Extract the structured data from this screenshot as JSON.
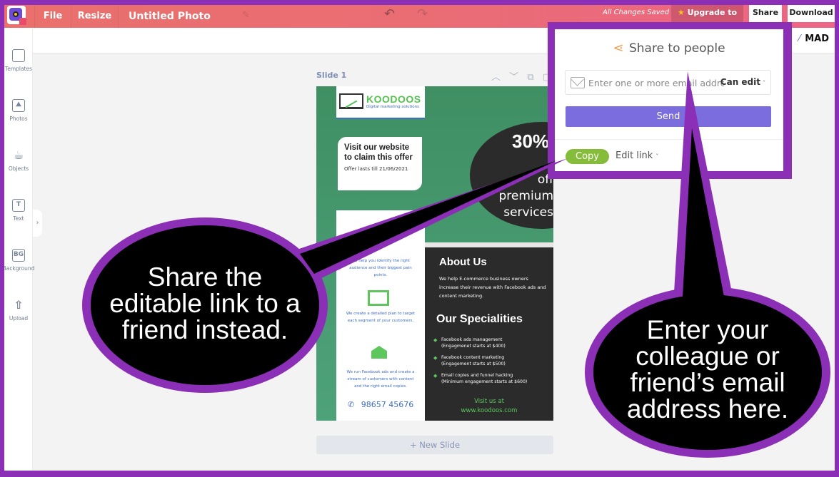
{
  "topbar": {
    "file_label": "File",
    "resize_label": "Resize",
    "document_title": "Untitled Photo",
    "save_status": "All Changes Saved",
    "upgrade_label": "Upgrade to pro",
    "share_label": "Share",
    "download_label": "Download"
  },
  "subbar": {
    "mad_label": "MAD"
  },
  "sidebar": {
    "items": [
      {
        "label": "Templates",
        "icon": "templates-icon"
      },
      {
        "label": "Photos",
        "icon": "photo-icon"
      },
      {
        "label": "Objects",
        "icon": "cup-icon"
      },
      {
        "label": "Text",
        "icon": "text-icon",
        "glyph": "T"
      },
      {
        "label": "Background",
        "icon": "background-icon",
        "glyph": "BG"
      },
      {
        "label": "Upload",
        "icon": "upload-icon",
        "glyph": "⇧"
      }
    ]
  },
  "canvas": {
    "slide_label": "Slide 1",
    "new_slide_label": "+ New Slide"
  },
  "slide": {
    "brand_name": "KOODOOS",
    "brand_tagline": "Digital marketing solutions",
    "offer_title": "Visit our website to claim this offer",
    "offer_date": "Offer lasts till 21/06/2021",
    "discount_pct": "30%",
    "discount_text": "off premium services",
    "step1_text": "We help you identify the right audience and their biggest pain points.",
    "step2_text": "We create a detailed plan to target each segment of your customers.",
    "step3_text": "We run Facebook ads and create a stream of customers with content and the right email copies.",
    "phone": "98657 45676",
    "about_title": "About Us",
    "about_body": "We help E-commerce business owners increase their revenue with Facebook ads and content marketing.",
    "specialities_title": "Our Specialities",
    "specialities": [
      {
        "line1": "Facebook ads management",
        "line2": "(Engagmenet starts at $400)"
      },
      {
        "line1": "Facebook content marketing",
        "line2": "(Engagement starts at $500)"
      },
      {
        "line1": "Email copies and funnel hacking",
        "line2": "(Minimum engagement starts at $600)"
      }
    ],
    "visit_line1": "Visit us at",
    "visit_line2": "www.koodoos.com"
  },
  "share_popup": {
    "heading": "Share to people",
    "email_placeholder": "Enter one or more email address",
    "email_value": "",
    "permission_selected": "Can edit",
    "send_label": "Send",
    "copy_label": "Copy",
    "edit_link_label": "Edit link"
  },
  "annotations": {
    "left_bubble": "Share the editable link to a friend instead.",
    "right_bubble": "Enter your colleague or friend’s email address here."
  },
  "colors": {
    "frame_purple": "#8a2fb6",
    "topbar_coral": "#e9706c",
    "send_button": "#7b6ddd",
    "copy_button": "#85bc3a",
    "slide_green": "#3f8f63",
    "accent_green": "#5dc75e"
  }
}
